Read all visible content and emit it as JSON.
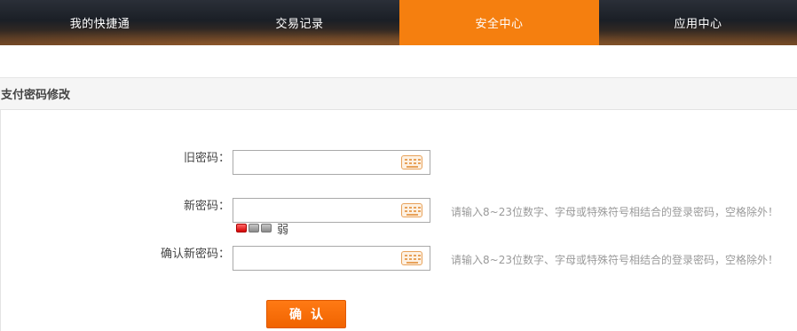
{
  "nav": {
    "tabs": [
      {
        "label": "我的快捷通",
        "active": false
      },
      {
        "label": "交易记录",
        "active": false
      },
      {
        "label": "安全中心",
        "active": true
      },
      {
        "label": "应用中心",
        "active": false
      }
    ],
    "active_color": "#f57f0f"
  },
  "section": {
    "title": "支付密码修改"
  },
  "form": {
    "old_password": {
      "label": "旧密码：",
      "value": ""
    },
    "new_password": {
      "label": "新密码：",
      "value": "",
      "hint": "请输入8~23位数字、字母或特殊符号相结合的登录密码，空格除外！"
    },
    "strength": {
      "level_text": "弱",
      "level": 1,
      "max_level": 3
    },
    "confirm_password": {
      "label": "确认新密码：",
      "value": "",
      "hint": "请输入8~23位数字、字母或特殊符号相结合的登录密码，空格除外！"
    },
    "submit_label": "确认",
    "submit_color": "#f57f0f"
  },
  "icons": {
    "keyboard": "keyboard-icon"
  }
}
